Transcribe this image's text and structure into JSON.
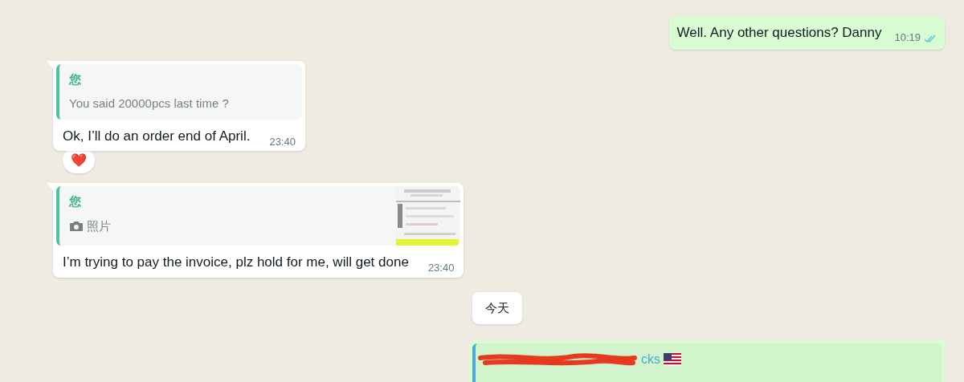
{
  "messages": [
    {
      "kind": "outgoing",
      "text": "Well. Any other questions? Danny",
      "time": "10:19",
      "read": true
    },
    {
      "kind": "incoming",
      "quote": {
        "author": "您",
        "text": "You said 20000pcs last time ?",
        "media": false
      },
      "text": "Ok, I’ll do an order end of April.",
      "time": "23:40",
      "reaction": "❤️"
    },
    {
      "kind": "incoming",
      "quote": {
        "author": "您",
        "text": "照片",
        "media": true
      },
      "text": "I’m trying to pay the invoice, plz hold for me, will get done",
      "time": "23:40"
    },
    {
      "kind": "date",
      "text": "今天"
    },
    {
      "kind": "outgoing_quote",
      "quote_author": "cks"
    }
  ]
}
